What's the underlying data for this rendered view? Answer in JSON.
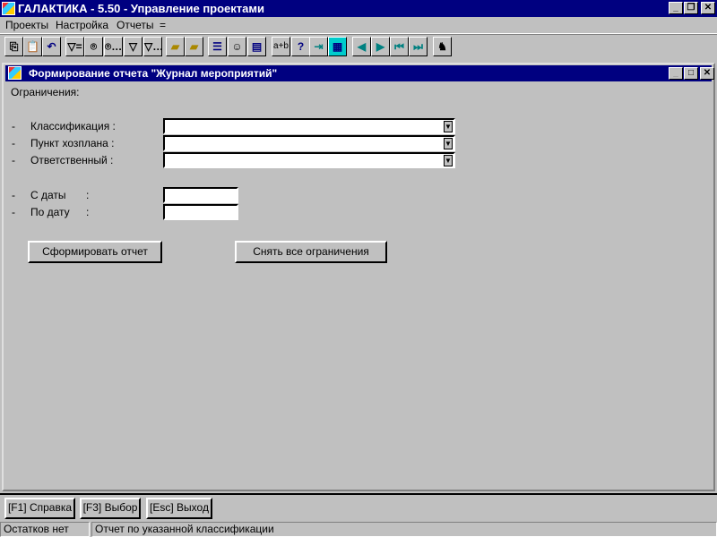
{
  "app": {
    "title": "ГАЛАКТИКА - 5.50 - Управление проектами"
  },
  "menu": [
    "Проекты",
    "Настройка",
    "Отчеты",
    "="
  ],
  "toolbar": [
    "copy-icon",
    "paste-icon",
    "undo-icon",
    "filter-icon",
    "find-icon",
    "find-next-icon",
    "filter-find-icon",
    "filter-find-next-icon",
    "open-folder-icon",
    "folder-search-icon",
    "list-icon",
    "smiley-icon",
    "table-icon",
    "calculator-icon",
    "help-icon",
    "exit-icon",
    "report-icon",
    "prev-icon",
    "next-icon",
    "first-icon",
    "last-icon",
    "footprints-icon"
  ],
  "child": {
    "title": "Формирование отчета \"Журнал мероприятий\"",
    "section": "Ограничения:"
  },
  "fields": {
    "classification": {
      "label": "Классификация :",
      "value": ""
    },
    "plan_item": {
      "label": "Пункт хозплана :",
      "value": ""
    },
    "responsible": {
      "label": "Ответственный :",
      "value": ""
    },
    "date_from": {
      "label": "С даты",
      "colon": ":",
      "value": ""
    },
    "date_to": {
      "label": "По дату",
      "colon": ":",
      "value": ""
    },
    "bullet": "-"
  },
  "buttons": {
    "generate": "Сформировать отчет",
    "clear": "Снять все ограничения"
  },
  "fkeys": {
    "help": "[F1] Справка",
    "select": "[F3] Выбор",
    "exit": "[Esc] Выход"
  },
  "status": {
    "left": "Остатков нет",
    "right": "Отчет по указанной классификации"
  }
}
